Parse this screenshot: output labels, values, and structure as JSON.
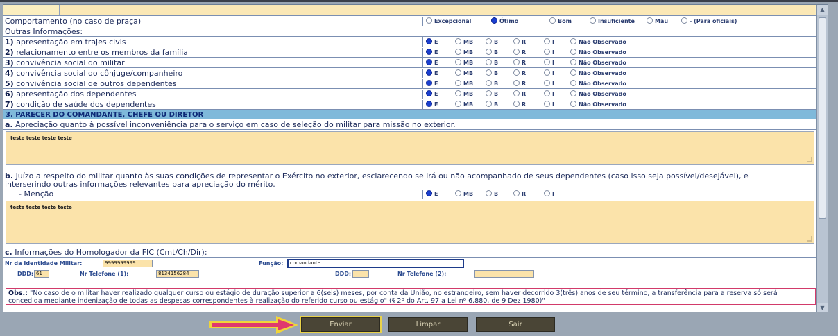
{
  "comportamento": {
    "label": "Comportamento (no caso de praça)",
    "options": [
      {
        "label": "Excepcional",
        "selected": false
      },
      {
        "label": "Ótimo",
        "selected": true
      },
      {
        "label": "Bom",
        "selected": false
      },
      {
        "label": "Insuficiente",
        "selected": false
      },
      {
        "label": "Mau",
        "selected": false
      },
      {
        "label": "- (Para oficiais)",
        "selected": false
      }
    ]
  },
  "outras": {
    "label": "Outras Informações:",
    "items": [
      {
        "num": "1)",
        "label": "apresentação em trajes civis"
      },
      {
        "num": "2)",
        "label": "relacionamento entre os membros da família"
      },
      {
        "num": "3)",
        "label": "convivência social do militar"
      },
      {
        "num": "4)",
        "label": "convivência social do cônjuge/companheiro"
      },
      {
        "num": "5)",
        "label": "convivência social de outros dependentes"
      },
      {
        "num": "6)",
        "label": "apresentação dos dependentes"
      },
      {
        "num": "7)",
        "label": "condição de saúde dos dependentes"
      }
    ],
    "options": [
      "E",
      "MB",
      "B",
      "R",
      "I",
      "Não Observado"
    ],
    "selected": "E"
  },
  "parecer": {
    "header": "3. PARECER DO COMANDANTE, CHEFE OU DIRETOR",
    "a_label_prefix": "a.",
    "a_label": "Apreciação quanto à possível inconveniência para o serviço em caso de seleção do militar para missão no exterior.",
    "a_text": "teste teste teste teste",
    "b_label_prefix": "b.",
    "b_label_line1": "Juízo a respeito do militar quanto às suas condições de representar o Exército no exterior, esclarecendo se irá ou não acompanhado de seus dependentes (caso isso seja possível/desejável), e",
    "b_label_line2": "interserindo outras informações relevantes para apreciação do mérito.",
    "mencao_label": "- Menção",
    "mencao_options": [
      "E",
      "MB",
      "B",
      "R",
      "I"
    ],
    "mencao_selected": "E",
    "b_text": "teste teste teste teste"
  },
  "homologador": {
    "label_prefix": "c.",
    "label": "Informações do Homologador da FIC (Cmt/Ch/Dir):",
    "identidade_label": "Nr da Identidade Militar:",
    "identidade_value": "9999999999",
    "funcao_label": "Função:",
    "funcao_value": "comandante",
    "ddd1_label": "DDD:",
    "ddd1_value": "61",
    "tel1_label": "Nr Telefone (1):",
    "tel1_value": "8134156284",
    "ddd2_label": "DDD:",
    "ddd2_value": "",
    "tel2_label": "Nr Telefone (2):",
    "tel2_value": ""
  },
  "obs": {
    "prefix": "Obs.:",
    "text": "\"No caso de o militar haver realizado qualquer curso ou estágio de duração superior a 6(seis) meses, por conta da União, no estrangeiro, sem haver decorrido 3(três) anos de seu término, a transferência para a reserva só será concedida mediante indenização de todas as despesas correspondentes à realização do referido curso ou estágio\" (§ 2º do Art. 97 a Lei nº 6.880, de 9 Dez 1980)\""
  },
  "buttons": {
    "enviar": "Enviar",
    "limpar": "Limpar",
    "sair": "Sair"
  },
  "colors": {
    "field_bg": "#fbe3aa",
    "section_header": "#7fb9da",
    "button_bg": "#4a4536",
    "arrow": "#e0376e",
    "arrow_outline": "#f0d43a"
  }
}
